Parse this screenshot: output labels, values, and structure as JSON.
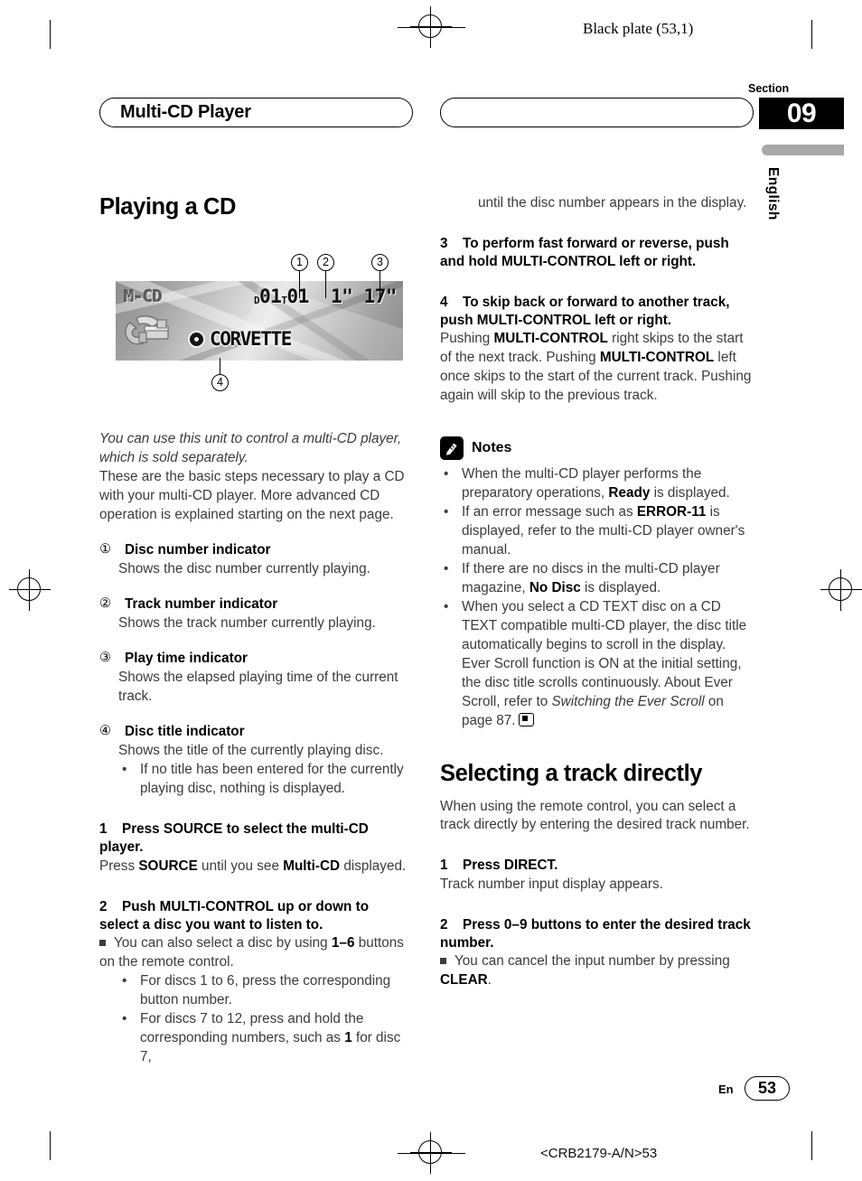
{
  "page": {
    "plate_text": "Black plate (53,1)",
    "section_label": "Section",
    "section_number": "09",
    "language_tab": "English",
    "running_head": "Multi-CD Player",
    "footer_language": "En",
    "footer_page": "53",
    "footer_code": "<CRB2179-A/N>53"
  },
  "figure": {
    "source_label": "M-CD",
    "disc_prefix": "D",
    "disc_number": "01",
    "track_prefix": "T",
    "track_number": "01",
    "play_time": "1\" 17\"",
    "disc_title": "CORVETTE",
    "callouts": [
      "1",
      "2",
      "3",
      "4"
    ]
  },
  "left_column": {
    "heading": "Playing a CD",
    "intro_italic": "You can use this unit to control a multi-CD player, which is sold separately.",
    "intro_body": "These are the basic steps necessary to play a CD with your multi-CD player. More advanced CD operation is explained starting on the next page.",
    "indicators": [
      {
        "marker": "①",
        "label": "Disc number indicator",
        "description": "Shows the disc number currently playing."
      },
      {
        "marker": "②",
        "label": "Track number indicator",
        "description": "Shows the track number currently playing."
      },
      {
        "marker": "③",
        "label": "Play time indicator",
        "description": "Shows the elapsed playing time of the current track."
      },
      {
        "marker": "④",
        "label": "Disc title indicator",
        "description": "Shows the title of the currently playing disc."
      }
    ],
    "indicator4_bullet": "If no title has been entered for the currently playing disc, nothing is displayed.",
    "step1_number": "1",
    "step1_heading": "Press SOURCE to select the multi-CD player.",
    "step1_body_a": "Press ",
    "step1_body_b": "SOURCE",
    "step1_body_c": " until you see ",
    "step1_body_d": "Multi-CD",
    "step1_body_e": " displayed.",
    "step2_number": "2",
    "step2_heading": "Push MULTI-CONTROL up or down to select a disc you want to listen to.",
    "step2_note_a": "You can also select a disc by using ",
    "step2_note_b": "1–6",
    "step2_note_c": " buttons on the remote control.",
    "step2_bullet1": "For discs 1 to 6, press the corresponding button number.",
    "step2_bullet2_a": "For discs 7 to 12, press and hold the corresponding numbers, such as ",
    "step2_bullet2_b": "1",
    "step2_bullet2_c": " for disc 7,"
  },
  "right_column": {
    "continued_text": "until the disc number appears in the display.",
    "step3_number": "3",
    "step3_heading": "To perform fast forward or reverse, push and hold MULTI-CONTROL left or right.",
    "step4_number": "4",
    "step4_heading": "To skip back or forward to another track, push MULTI-CONTROL left or right.",
    "step4_body_a": "Pushing ",
    "step4_body_b": "MULTI-CONTROL",
    "step4_body_c": " right skips to the start of the next track. Pushing ",
    "step4_body_d": "MULTI-CONTROL",
    "step4_body_e": " left once skips to the start of the current track. Pushing again will skip to the previous track.",
    "notes_title": "Notes",
    "notes_icon": "pencil-icon",
    "note1_a": "When the multi-CD player performs the preparatory operations, ",
    "note1_b": "Ready",
    "note1_c": " is displayed.",
    "note2_a": "If an error message such as ",
    "note2_b": "ERROR-11",
    "note2_c": " is displayed, refer to the multi-CD player owner's manual.",
    "note3_a": "If there are no discs in the multi-CD player magazine, ",
    "note3_b": "No Disc",
    "note3_c": " is displayed.",
    "note4_a": "When you select a CD TEXT disc on a CD TEXT compatible multi-CD player, the disc title automatically begins to scroll in the display. Ever Scroll function is ON at the initial setting, the disc title scrolls continuously. About Ever Scroll, refer to ",
    "note4_b": "Switching the Ever Scroll",
    "note4_c": " on page 87.",
    "heading2": "Selecting a track directly",
    "intro2": "When using the remote control, you can select a track directly by entering the desired track number.",
    "s1_number": "1",
    "s1_heading": "Press DIRECT.",
    "s1_body": "Track number input display appears.",
    "s2_number": "2",
    "s2_heading": "Press 0–9 buttons to enter the desired track number.",
    "s2_note_a": "You can cancel the input number by pressing ",
    "s2_note_b": "CLEAR",
    "s2_note_c": "."
  }
}
